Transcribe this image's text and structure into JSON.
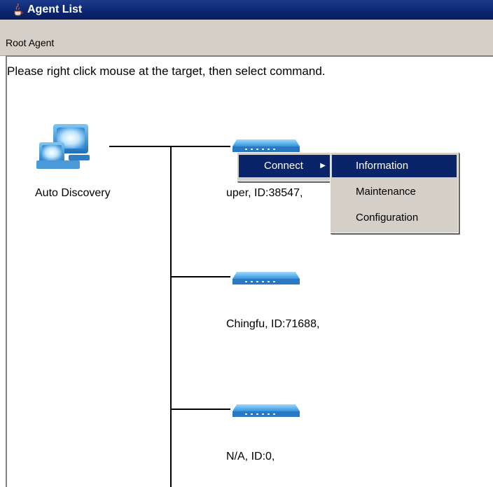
{
  "window": {
    "title": "Agent List",
    "icon": "java-cup-icon"
  },
  "menubar": {
    "items": [
      "Root Agent"
    ]
  },
  "canvas": {
    "hint": "Please right click mouse at the target, then select command.",
    "root": {
      "label": "Auto Discovery",
      "icon": "computer-icon"
    },
    "devices": [
      {
        "label": "uper, ID:38547,",
        "icon": "switch-icon"
      },
      {
        "label": "Chingfu, ID:71688,",
        "icon": "switch-icon"
      },
      {
        "label": "N/A, ID:0,",
        "icon": "switch-icon"
      }
    ]
  },
  "context_menu": {
    "item": {
      "label": "Connect",
      "arrow": "▶"
    },
    "submenu": [
      "Information",
      "Maintenance",
      "Configuration"
    ],
    "selected": "Information"
  },
  "colors": {
    "titlebar": "#0a246a",
    "selection": "#0a246a",
    "chrome": "#d4d0c8"
  }
}
